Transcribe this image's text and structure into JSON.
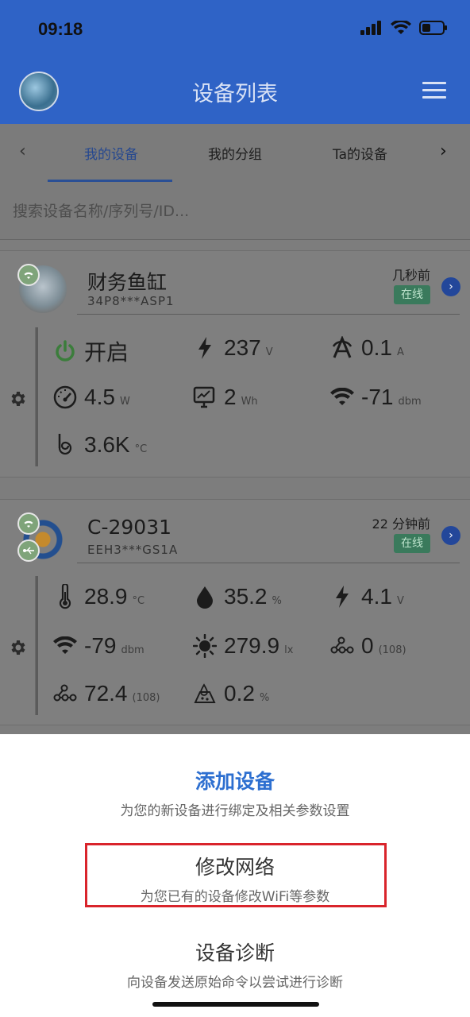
{
  "status_bar": {
    "time": "09:18"
  },
  "header": {
    "title": "设备列表"
  },
  "tabs": [
    {
      "label": "我的设备",
      "active": true
    },
    {
      "label": "我的分组",
      "active": false
    },
    {
      "label": "Ta的设备",
      "active": false
    }
  ],
  "search": {
    "placeholder": "搜索设备名称/序列号/ID..."
  },
  "devices": [
    {
      "name": "财务鱼缸",
      "serial": "34P8***ASP1",
      "last_seen": "几秒前",
      "status": "在线",
      "metrics": [
        {
          "icon": "power-icon",
          "value": "开启",
          "unit": ""
        },
        {
          "icon": "lightning-icon",
          "value": "237",
          "unit": "V"
        },
        {
          "icon": "current-icon",
          "value": "0.1",
          "unit": "A"
        },
        {
          "icon": "gauge-icon",
          "value": "4.5",
          "unit": "W"
        },
        {
          "icon": "energy-monitor-icon",
          "value": "2",
          "unit": "Wh"
        },
        {
          "icon": "wifi-signal-icon",
          "value": "-71",
          "unit": "dbm"
        },
        {
          "icon": "spiral-temp-icon",
          "value": "3.6K",
          "unit": "°C"
        }
      ]
    },
    {
      "name": "C-29031",
      "serial": "EEH3***GS1A",
      "last_seen": "22 分钟前",
      "status": "在线",
      "metrics": [
        {
          "icon": "thermometer-icon",
          "value": "28.9",
          "unit": "°C"
        },
        {
          "icon": "droplet-icon",
          "value": "35.2",
          "unit": "%"
        },
        {
          "icon": "lightning-icon",
          "value": "4.1",
          "unit": "V"
        },
        {
          "icon": "wifi-signal-icon",
          "value": "-79",
          "unit": "dbm"
        },
        {
          "icon": "sun-icon",
          "value": "279.9",
          "unit": "lx"
        },
        {
          "icon": "molecule-icon",
          "value": "0",
          "unit": "(108)"
        },
        {
          "icon": "molecule-icon",
          "value": "72.4",
          "unit": "(108)"
        },
        {
          "icon": "soil-moisture-icon",
          "value": "0.2",
          "unit": "%"
        }
      ]
    }
  ],
  "sheet": {
    "items": [
      {
        "title": "添加设备",
        "subtitle": "为您的新设备进行绑定及相关参数设置"
      },
      {
        "title": "修改网络",
        "subtitle": "为您已有的设备修改WiFi等参数"
      },
      {
        "title": "设备诊断",
        "subtitle": "向设备发送原始命令以尝试进行诊断"
      }
    ]
  },
  "colors": {
    "header": "#2f63c6",
    "accent": "#2d6fd0",
    "online_badge": "#3a7a5c",
    "highlight_box": "#d9242b"
  }
}
